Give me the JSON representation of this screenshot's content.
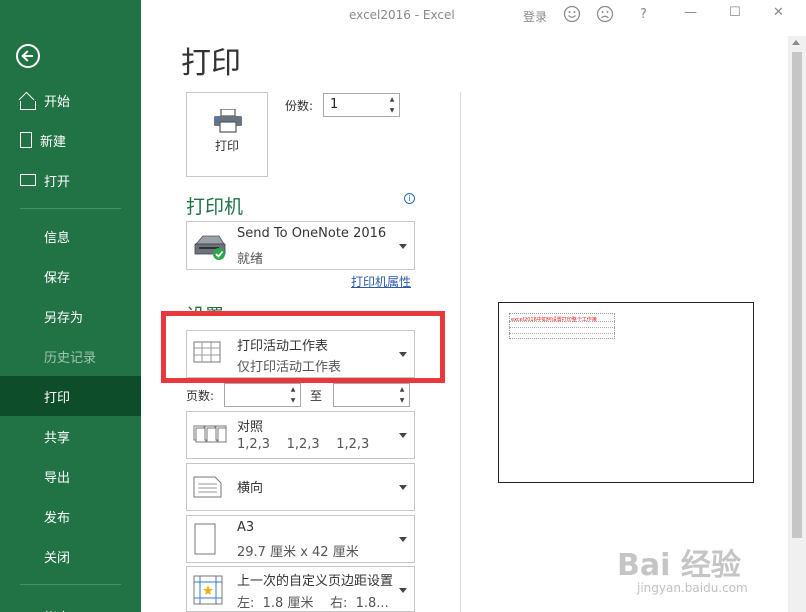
{
  "titlebar": {
    "title": "excel2016 - Excel",
    "login": "登录",
    "help": "?",
    "minimize": "—",
    "restore": "☐",
    "close": "✕"
  },
  "sidebar": {
    "items": [
      {
        "label": "开始"
      },
      {
        "label": "新建"
      },
      {
        "label": "打开"
      },
      {
        "label": "信息"
      },
      {
        "label": "保存"
      },
      {
        "label": "另存为"
      },
      {
        "label": "历史记录"
      },
      {
        "label": "打印"
      },
      {
        "label": "共享"
      },
      {
        "label": "导出"
      },
      {
        "label": "发布"
      },
      {
        "label": "关闭"
      },
      {
        "label": "帐户"
      }
    ]
  },
  "main": {
    "title": "打印",
    "print_button": "打印",
    "copies_label": "份数:",
    "copies_value": "1",
    "printer_header": "打印机",
    "info": "i",
    "printer_name": "Send To OneNote 2016",
    "printer_status": "就绪",
    "printer_props": "打印机属性",
    "settings_header": "设置",
    "print_what": "打印活动工作表",
    "print_what_sub": "仅打印活动工作表",
    "pages_label": "页数:",
    "to_label": "至",
    "collate": "对照",
    "collate_sub": "1,2,3    1,2,3    1,2,3",
    "orientation": "横向",
    "paper": "A3",
    "paper_sub": "29.7 厘米 x 42 厘米",
    "margins": "上一次的自定义页边距设置",
    "margins_sub": "左:  1.8 厘米    右:  1.8..."
  },
  "preview": {
    "text": "excel2016中如何设置打印整个工作簿"
  },
  "watermark": {
    "main": "Bai 经验",
    "sub": "jingyan.baidu.com"
  },
  "colors": {
    "sidebar": "#217346",
    "sidebar_active": "#0e4d2a",
    "accent": "#217346",
    "highlight": "#e8383d"
  }
}
